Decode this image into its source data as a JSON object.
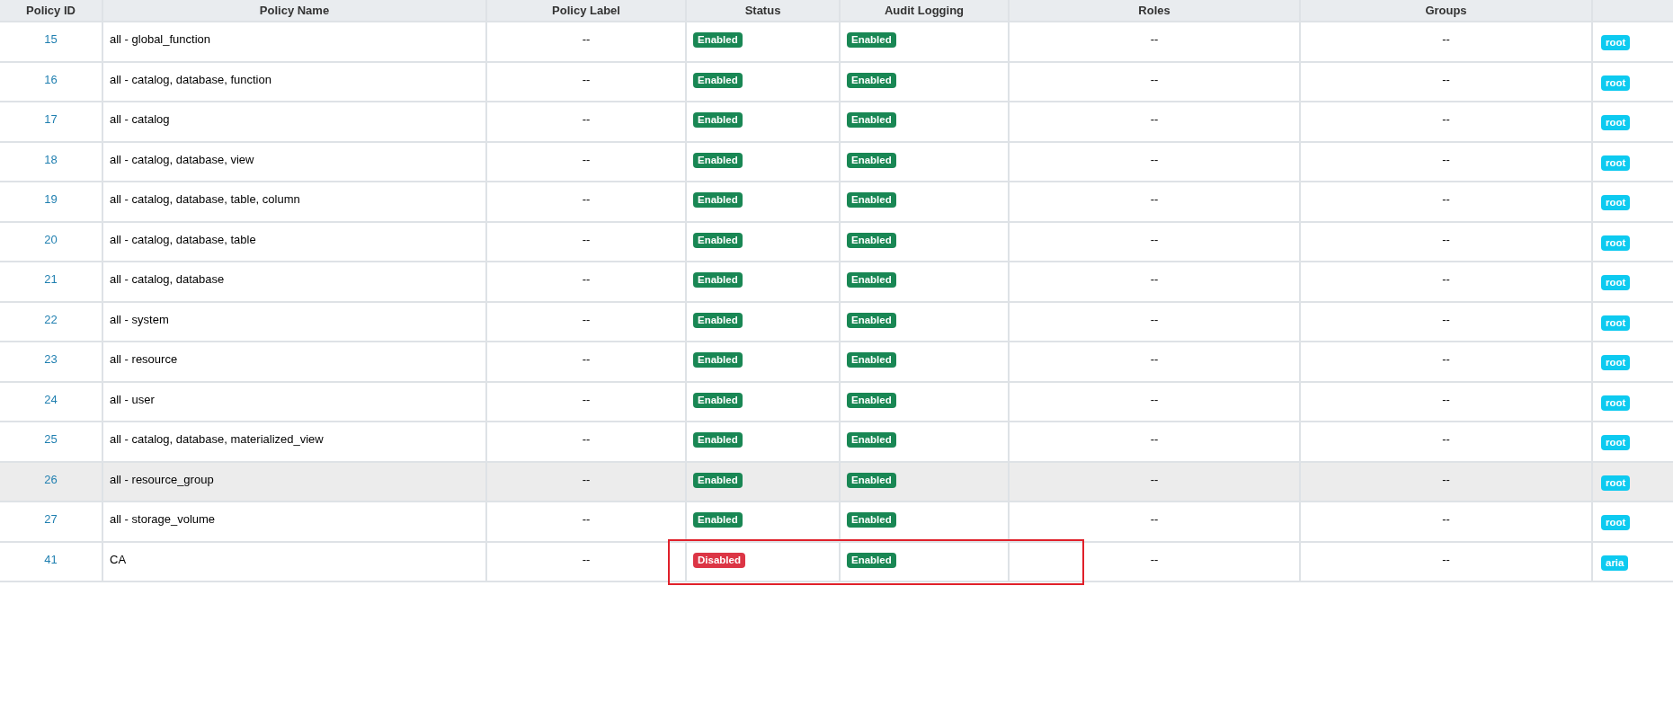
{
  "table": {
    "columns": [
      "Policy ID",
      "Policy Name",
      "Policy Label",
      "Status",
      "Audit Logging",
      "Roles",
      "Groups"
    ],
    "rows": [
      {
        "id": "15",
        "name": "all - global_function",
        "label": "--",
        "status": {
          "text": "Enabled",
          "kind": "enabled"
        },
        "audit": {
          "text": "Enabled",
          "kind": "enabled"
        },
        "roles": "--",
        "groups": "--",
        "user": "root",
        "highlighted": false,
        "boxed": false
      },
      {
        "id": "16",
        "name": "all - catalog, database, function",
        "label": "--",
        "status": {
          "text": "Enabled",
          "kind": "enabled"
        },
        "audit": {
          "text": "Enabled",
          "kind": "enabled"
        },
        "roles": "--",
        "groups": "--",
        "user": "root",
        "highlighted": false,
        "boxed": false
      },
      {
        "id": "17",
        "name": "all - catalog",
        "label": "--",
        "status": {
          "text": "Enabled",
          "kind": "enabled"
        },
        "audit": {
          "text": "Enabled",
          "kind": "enabled"
        },
        "roles": "--",
        "groups": "--",
        "user": "root",
        "highlighted": false,
        "boxed": false
      },
      {
        "id": "18",
        "name": "all - catalog, database, view",
        "label": "--",
        "status": {
          "text": "Enabled",
          "kind": "enabled"
        },
        "audit": {
          "text": "Enabled",
          "kind": "enabled"
        },
        "roles": "--",
        "groups": "--",
        "user": "root",
        "highlighted": false,
        "boxed": false
      },
      {
        "id": "19",
        "name": "all - catalog, database, table, column",
        "label": "--",
        "status": {
          "text": "Enabled",
          "kind": "enabled"
        },
        "audit": {
          "text": "Enabled",
          "kind": "enabled"
        },
        "roles": "--",
        "groups": "--",
        "user": "root",
        "highlighted": false,
        "boxed": false
      },
      {
        "id": "20",
        "name": "all - catalog, database, table",
        "label": "--",
        "status": {
          "text": "Enabled",
          "kind": "enabled"
        },
        "audit": {
          "text": "Enabled",
          "kind": "enabled"
        },
        "roles": "--",
        "groups": "--",
        "user": "root",
        "highlighted": false,
        "boxed": false
      },
      {
        "id": "21",
        "name": "all - catalog, database",
        "label": "--",
        "status": {
          "text": "Enabled",
          "kind": "enabled"
        },
        "audit": {
          "text": "Enabled",
          "kind": "enabled"
        },
        "roles": "--",
        "groups": "--",
        "user": "root",
        "highlighted": false,
        "boxed": false
      },
      {
        "id": "22",
        "name": "all - system",
        "label": "--",
        "status": {
          "text": "Enabled",
          "kind": "enabled"
        },
        "audit": {
          "text": "Enabled",
          "kind": "enabled"
        },
        "roles": "--",
        "groups": "--",
        "user": "root",
        "highlighted": false,
        "boxed": false
      },
      {
        "id": "23",
        "name": "all - resource",
        "label": "--",
        "status": {
          "text": "Enabled",
          "kind": "enabled"
        },
        "audit": {
          "text": "Enabled",
          "kind": "enabled"
        },
        "roles": "--",
        "groups": "--",
        "user": "root",
        "highlighted": false,
        "boxed": false
      },
      {
        "id": "24",
        "name": "all - user",
        "label": "--",
        "status": {
          "text": "Enabled",
          "kind": "enabled"
        },
        "audit": {
          "text": "Enabled",
          "kind": "enabled"
        },
        "roles": "--",
        "groups": "--",
        "user": "root",
        "highlighted": false,
        "boxed": false
      },
      {
        "id": "25",
        "name": "all - catalog, database, materialized_view",
        "label": "--",
        "status": {
          "text": "Enabled",
          "kind": "enabled"
        },
        "audit": {
          "text": "Enabled",
          "kind": "enabled"
        },
        "roles": "--",
        "groups": "--",
        "user": "root",
        "highlighted": false,
        "boxed": false
      },
      {
        "id": "26",
        "name": "all - resource_group",
        "label": "--",
        "status": {
          "text": "Enabled",
          "kind": "enabled"
        },
        "audit": {
          "text": "Enabled",
          "kind": "enabled"
        },
        "roles": "--",
        "groups": "--",
        "user": "root",
        "highlighted": true,
        "boxed": false
      },
      {
        "id": "27",
        "name": "all - storage_volume",
        "label": "--",
        "status": {
          "text": "Enabled",
          "kind": "enabled"
        },
        "audit": {
          "text": "Enabled",
          "kind": "enabled"
        },
        "roles": "--",
        "groups": "--",
        "user": "root",
        "highlighted": false,
        "boxed": false
      },
      {
        "id": "41",
        "name": "CA",
        "label": "--",
        "status": {
          "text": "Disabled",
          "kind": "disabled"
        },
        "audit": {
          "text": "Enabled",
          "kind": "enabled"
        },
        "roles": "--",
        "groups": "--",
        "user": "aria",
        "highlighted": false,
        "boxed": true
      }
    ]
  }
}
